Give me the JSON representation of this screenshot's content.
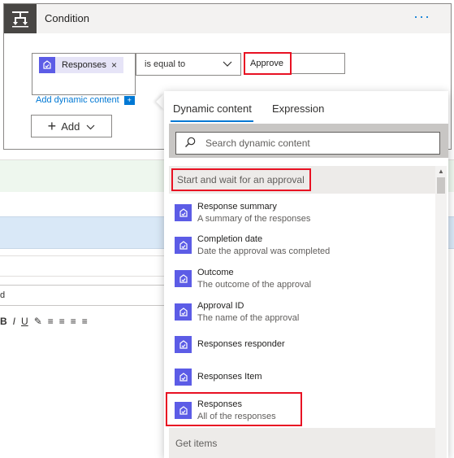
{
  "condition": {
    "title": "Condition",
    "more_label": "···",
    "token_label": "Responses",
    "token_close": "×",
    "operator": "is equal to",
    "value": "Approve",
    "add_dynamic_label": "Add dynamic content",
    "add_dynamic_badge": "+",
    "add_button_label": "Add"
  },
  "background": {
    "field_value": "d",
    "toolbar": [
      "B",
      "I",
      "U",
      "✎",
      "≡",
      "≡",
      "≡",
      "≡",
      "≡",
      "≡"
    ]
  },
  "panel": {
    "tabs": [
      "Dynamic content",
      "Expression"
    ],
    "active_tab": "Dynamic content",
    "search_placeholder": "Search dynamic content",
    "section": "Start and wait for an approval",
    "items": [
      {
        "title": "Response summary",
        "desc": "A summary of the responses"
      },
      {
        "title": "Completion date",
        "desc": "Date the approval was completed"
      },
      {
        "title": "Outcome",
        "desc": "The outcome of the approval"
      },
      {
        "title": "Approval ID",
        "desc": "The name of the approval"
      },
      {
        "title": "Responses responder",
        "desc": ""
      },
      {
        "title": "Responses Item",
        "desc": ""
      },
      {
        "title": "Responses",
        "desc": "All of the responses"
      }
    ],
    "next_section": "Get items"
  },
  "icons": {
    "condition": "condition-icon",
    "approval": "approval-icon",
    "search": "search-icon",
    "chevron": "chevron-down-icon"
  },
  "colors": {
    "accent": "#0078d4",
    "highlight": "#e81123",
    "approval_icon": "#5c5ce6"
  }
}
